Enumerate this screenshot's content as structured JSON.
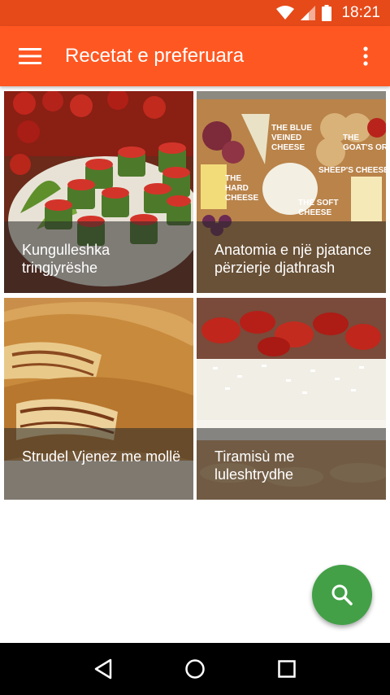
{
  "status_bar": {
    "time": "18:21",
    "icons": [
      "wifi-icon",
      "signal-icon",
      "battery-icon"
    ]
  },
  "app_bar": {
    "title": "Recetat e preferuara",
    "menu_icon": "menu-icon",
    "overflow_icon": "more-vert-icon"
  },
  "recipes": [
    {
      "title": "Kungulleshka tringjyrëshe"
    },
    {
      "title": "Anatomia e një pjatance përzierje djathrash"
    },
    {
      "title": "Strudel Vjenez me mollë"
    },
    {
      "title": "Tiramisù me luleshtrydhe"
    }
  ],
  "fab": {
    "icon": "search-icon"
  },
  "nav_bar": {
    "icons": [
      "back-icon",
      "home-icon",
      "recents-icon"
    ]
  },
  "colors": {
    "status_bar": "#e64a19",
    "app_bar": "#ff5722",
    "fab": "#43a047",
    "nav_bar": "#000000"
  }
}
